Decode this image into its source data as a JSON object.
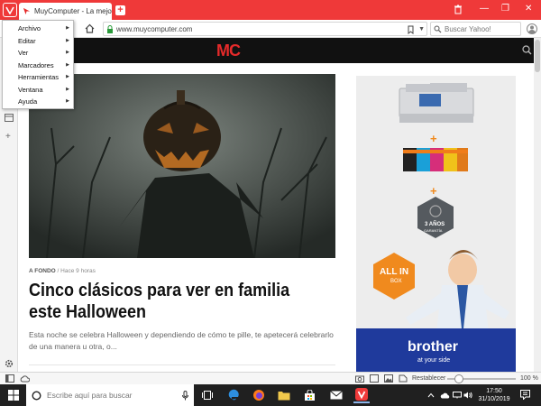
{
  "tab": {
    "title": "MuyComputer - La mejor in",
    "close": "×"
  },
  "new_tab": "+",
  "window_controls": {
    "minimize": "—",
    "maximize": "❐",
    "close": "✕"
  },
  "address": {
    "url": "www.muycomputer.com",
    "search_placeholder": "Buscar Yahoo!"
  },
  "menu": [
    {
      "label": "Archivo"
    },
    {
      "label": "Editar"
    },
    {
      "label": "Ver"
    },
    {
      "label": "Marcadores"
    },
    {
      "label": "Herramientas"
    },
    {
      "label": "Ventana"
    },
    {
      "label": "Ayuda"
    }
  ],
  "site": {
    "logo": "MC"
  },
  "article": {
    "category": "A FONDO",
    "separator": "/",
    "time": "Hace 9 horas",
    "headline": "Cinco clásicos para ver en familia este Halloween",
    "excerpt": "Esta noche se celebra Halloween y dependiendo de cómo te pille, te apetecerá celebrarlo de una manera u otra, o..."
  },
  "ad": {
    "plus": "+",
    "warranty": "3 AÑOS",
    "warranty_sub": "GARANTÍA",
    "allin": "ALL IN",
    "box": "BOX",
    "brand": "brother",
    "tagline": "at your side"
  },
  "statusbar": {
    "reset_label": "Restablecer",
    "zoom": "100 %",
    "zoom_fraction": 0.17
  },
  "taskbar": {
    "search_placeholder": "Escribe aquí para buscar",
    "time": "17:50",
    "date": "31/10/2019"
  },
  "colors": {
    "brand_red": "#ef3939",
    "mc_red": "#e52a2a",
    "brother_blue": "#1f3a9c"
  }
}
